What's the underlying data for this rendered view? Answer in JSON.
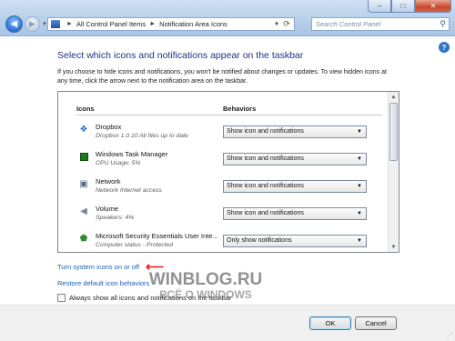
{
  "window": {
    "minimize_glyph": "–",
    "maximize_glyph": "□",
    "close_glyph": "✕"
  },
  "address_bar": {
    "segments": [
      "All Control Panel Items",
      "Notification Area Icons"
    ],
    "separator": "►"
  },
  "search": {
    "placeholder": "Search Control Panel"
  },
  "main": {
    "heading": "Select which icons and notifications appear on the taskbar",
    "description": "If you choose to hide icons and notifications, you won't be notified about changes or updates. To view hidden icons at any time, click the arrow next to the notification area on the taskbar.",
    "columns": {
      "icons": "Icons",
      "behaviors": "Behaviors"
    },
    "rows": [
      {
        "name": "Dropbox",
        "status": "Dropbox 1.0.10 All files up to date",
        "behavior": "Show icon and notifications",
        "icon": "dropbox-icon",
        "icon_color": "#1c6fd6"
      },
      {
        "name": "Windows Task Manager",
        "status": "CPU Usage: 5%",
        "behavior": "Show icon and notifications",
        "icon": "task-manager-icon",
        "icon_color": "#1b7a1b"
      },
      {
        "name": "Network",
        "status": "Network Internet access",
        "behavior": "Show icon and notifications",
        "icon": "network-icon",
        "icon_color": "#5a6b80"
      },
      {
        "name": "Volume",
        "status": "Speakers: 4%",
        "behavior": "Show icon and notifications",
        "icon": "volume-icon",
        "icon_color": "#7a8494"
      },
      {
        "name": "Microsoft Security Essentials User Inte...",
        "status": "Computer status - Protected",
        "behavior": "Only show notifications",
        "icon": "security-essentials-icon",
        "icon_color": "#2e8b2e"
      }
    ],
    "links": {
      "system_icons": "Turn system icons on or off",
      "restore_defaults": "Restore default icon behaviors"
    },
    "always_show_label": "Always show all icons and notifications on the taskbar"
  },
  "footer": {
    "ok": "OK",
    "cancel": "Cancel"
  },
  "watermark": {
    "line1": "WINBLOG.RU",
    "line2": "ВСЁ О WINDOWS"
  },
  "colors": {
    "heading": "#1e3287",
    "link": "#1a5fb4",
    "arrow": "#e21b1b"
  }
}
